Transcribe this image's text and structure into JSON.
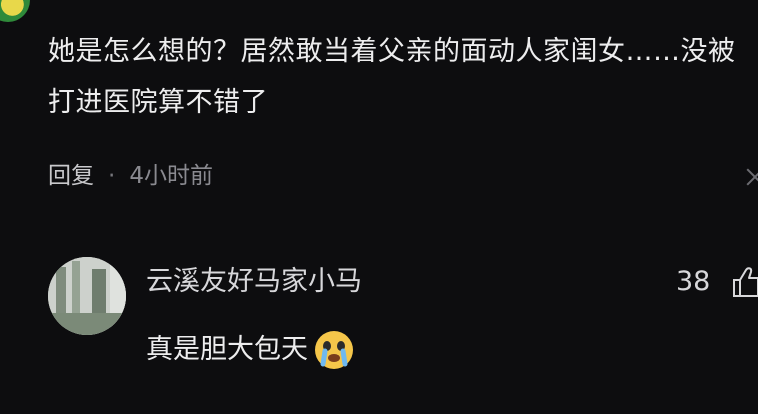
{
  "comment": {
    "text": "她是怎么想的？居然敢当着父亲的面动人家闺女……没被打进医院算不错了",
    "reply_label": "回复",
    "separator": "·",
    "time": "4小时前"
  },
  "reply": {
    "username": "云溪友好马家小马",
    "likes": "38",
    "text": "真是胆大包天"
  },
  "icons": {
    "close": "close-icon",
    "like": "thumbs-up-icon",
    "emoji": "crying-face-emoji"
  },
  "colors": {
    "background": "#0d0d0f",
    "text": "#ededee",
    "muted": "#8a8a90"
  }
}
